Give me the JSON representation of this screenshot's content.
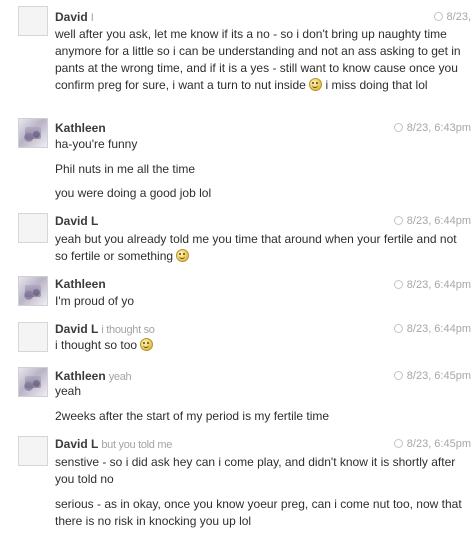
{
  "messages": [
    {
      "sender": "David",
      "preview": "I",
      "time": "8/23,",
      "lines": [
        "well after you ask, let me know if its a no - so i don't bring up naughty time anymore for a little so i can be understanding and not an ass asking to get in pants at the wrong time, and if it is a yes - still want to know cause once you confirm preg for sure, i want a turn to nut inside",
        "i miss doing that lol"
      ]
    },
    {
      "sender": "Kathleen",
      "preview": "",
      "time": "8/23, 6:43pm",
      "lines": [
        "ha-you're funny",
        "Phil nuts in me all the time",
        "you were doing a good job lol"
      ]
    },
    {
      "sender": "David L",
      "preview": "",
      "time": "8/23, 6:44pm",
      "lines": [
        "yeah but you already told me you time that around when your fertile and not so fertile or something"
      ]
    },
    {
      "sender": "Kathleen",
      "preview": "",
      "time": "8/23, 6:44pm",
      "lines": [
        "I'm proud of yo"
      ]
    },
    {
      "sender": "David L",
      "preview": "i thought so",
      "time": "8/23, 6:44pm",
      "lines": [
        "i thought so too"
      ]
    },
    {
      "sender": "Kathleen",
      "preview": "yeah",
      "time": "8/23, 6:45pm",
      "lines": [
        "yeah",
        "2weeks after the start of my period is my fertile time"
      ]
    },
    {
      "sender": "David L",
      "preview": "but you told me",
      "time": "8/23, 6:45pm",
      "lines": [
        "senstive - so i did ask hey can i come play, and didn't know it is shortly after you told no",
        "serious - as in okay, once you know yoeur preg, can i come nut too, now that there is no risk in knocking you up lol"
      ]
    }
  ]
}
